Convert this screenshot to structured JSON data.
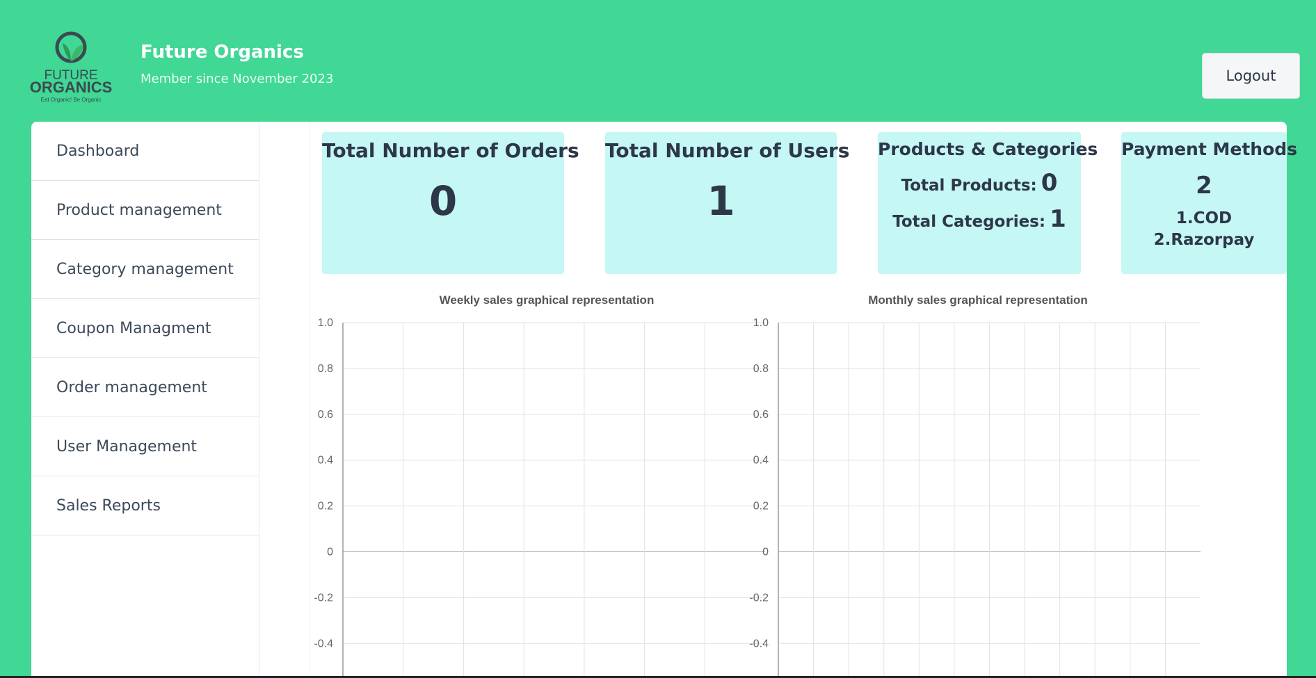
{
  "header": {
    "logo": {
      "line1": "FUTURE",
      "line2": "ORGANICS",
      "tagline": "Eat Organic! Be Organic"
    },
    "title": "Future Organics",
    "subtitle": "Member since November 2023",
    "logout_label": "Logout"
  },
  "sidebar": {
    "items": [
      {
        "label": "Dashboard"
      },
      {
        "label": "Product management"
      },
      {
        "label": "Category management"
      },
      {
        "label": "Coupon Managment"
      },
      {
        "label": "Order management"
      },
      {
        "label": "User Management"
      },
      {
        "label": "Sales Reports"
      }
    ]
  },
  "stats": {
    "orders": {
      "title": "Total Number of Orders",
      "value": "0"
    },
    "users": {
      "title": "Total Number of Users",
      "value": "1"
    },
    "products": {
      "title": "Products & Categories",
      "products_label": "Total Products:",
      "products_value": "0",
      "categories_label": "Total Categories:",
      "categories_value": "1"
    },
    "payments": {
      "title": "Payment Methods",
      "count": "2",
      "method1": "1.COD",
      "method2": "2.Razorpay"
    }
  },
  "colors": {
    "background": "#41d795",
    "card": "#c5f7f5",
    "panel": "#ffffff",
    "text": "#2d3748"
  },
  "chart_data": [
    {
      "type": "line",
      "title": "Weekly sales graphical representation",
      "x": [],
      "series": [],
      "yticks": [
        "1.0",
        "0.8",
        "0.6",
        "0.4",
        "0.2",
        "0",
        "-0.2",
        "-0.4"
      ],
      "ylim": [
        -0.4,
        1.0
      ],
      "x_gridlines": 7,
      "grid": true
    },
    {
      "type": "line",
      "title": "Monthly sales graphical representation",
      "x": [],
      "series": [],
      "yticks": [
        "1.0",
        "0.8",
        "0.6",
        "0.4",
        "0.2",
        "0",
        "-0.2",
        "-0.4"
      ],
      "ylim": [
        -0.4,
        1.0
      ],
      "x_gridlines": 12,
      "grid": true
    }
  ]
}
